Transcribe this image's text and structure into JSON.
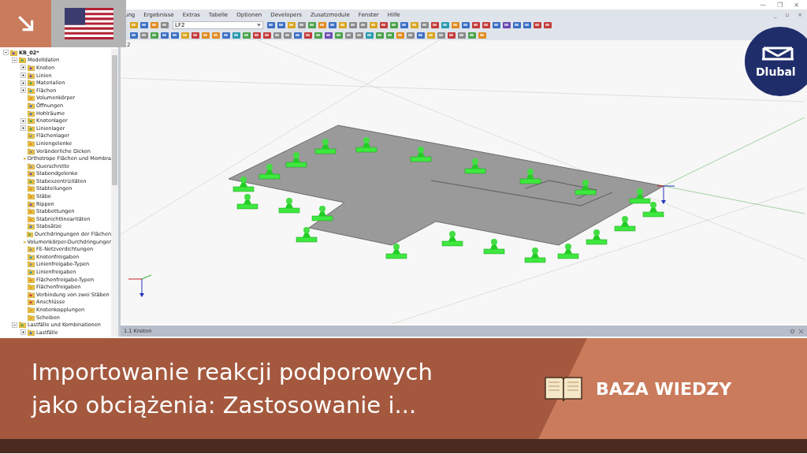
{
  "window": {
    "controls": [
      "—",
      "❐",
      "✕"
    ]
  },
  "menu": {
    "items": [
      "ung",
      "Ergebnisse",
      "Extras",
      "Tabelle",
      "Optionen",
      "Developers",
      "Zusatzmodule",
      "Fenster",
      "Hilfe"
    ],
    "mdi_controls": [
      "_",
      "▫",
      "×"
    ]
  },
  "toolbar": {
    "loadcase": "LF2"
  },
  "tree": {
    "items": [
      {
        "label": "KB_02*",
        "expanded": true,
        "children": [
          {
            "label": "Modelldaten",
            "expanded": true,
            "children": [
              {
                "label": "Knoten",
                "expanded": false
              },
              {
                "label": "Linien",
                "expanded": false
              },
              {
                "label": "Materialien",
                "expanded": false
              },
              {
                "label": "Flächen",
                "expanded": false
              },
              {
                "label": "Volumenkörper"
              },
              {
                "label": "Öffnungen"
              },
              {
                "label": "Hohlräume"
              },
              {
                "label": "Knotenlager",
                "expanded": false
              },
              {
                "label": "Linienlager",
                "expanded": false
              },
              {
                "label": "Flächenlager"
              },
              {
                "label": "Liniengelenke"
              },
              {
                "label": "Veränderliche Dicken"
              },
              {
                "label": "Orthotrope Flächen und Membra"
              },
              {
                "label": "Querschnitte"
              },
              {
                "label": "Stabendgelenke"
              },
              {
                "label": "Stabexzentrizitäten"
              },
              {
                "label": "Stabteilungen"
              },
              {
                "label": "Stäbe"
              },
              {
                "label": "Rippen"
              },
              {
                "label": "Stabbettungen"
              },
              {
                "label": "Stabnichtlinearitäten"
              },
              {
                "label": "Stabsätze"
              },
              {
                "label": "Durchdringungen der Flächen"
              },
              {
                "label": "Volumenkörper-Durchdringunger"
              },
              {
                "label": "FE-Netzverdichtungen"
              },
              {
                "label": "Knotenfreigaben"
              },
              {
                "label": "Linienfreigabe-Typen"
              },
              {
                "label": "Linienfreigaben"
              },
              {
                "label": "Flächenfreigabe-Typen"
              },
              {
                "label": "Flächenfreigaben"
              },
              {
                "label": "Verbindung von zwei Stäben"
              },
              {
                "label": "Anschlüsse"
              },
              {
                "label": "Knotenkopplungen"
              },
              {
                "label": "Scheiben"
              }
            ]
          },
          {
            "label": "Lastfälle und Kombinationen",
            "expanded": true,
            "children": [
              {
                "label": "Lastfälle",
                "expanded": false
              }
            ]
          }
        ]
      }
    ]
  },
  "viewport": {
    "label": "2"
  },
  "panel": {
    "title": "1.1 Knoten"
  },
  "logo": {
    "text": "Dlubal"
  },
  "banner": {
    "title_lines": [
      "Importowanie reakcji podporowych",
      "jako obciążenia: Zastosowanie i..."
    ],
    "tag": "BAZA WIEDZY"
  }
}
